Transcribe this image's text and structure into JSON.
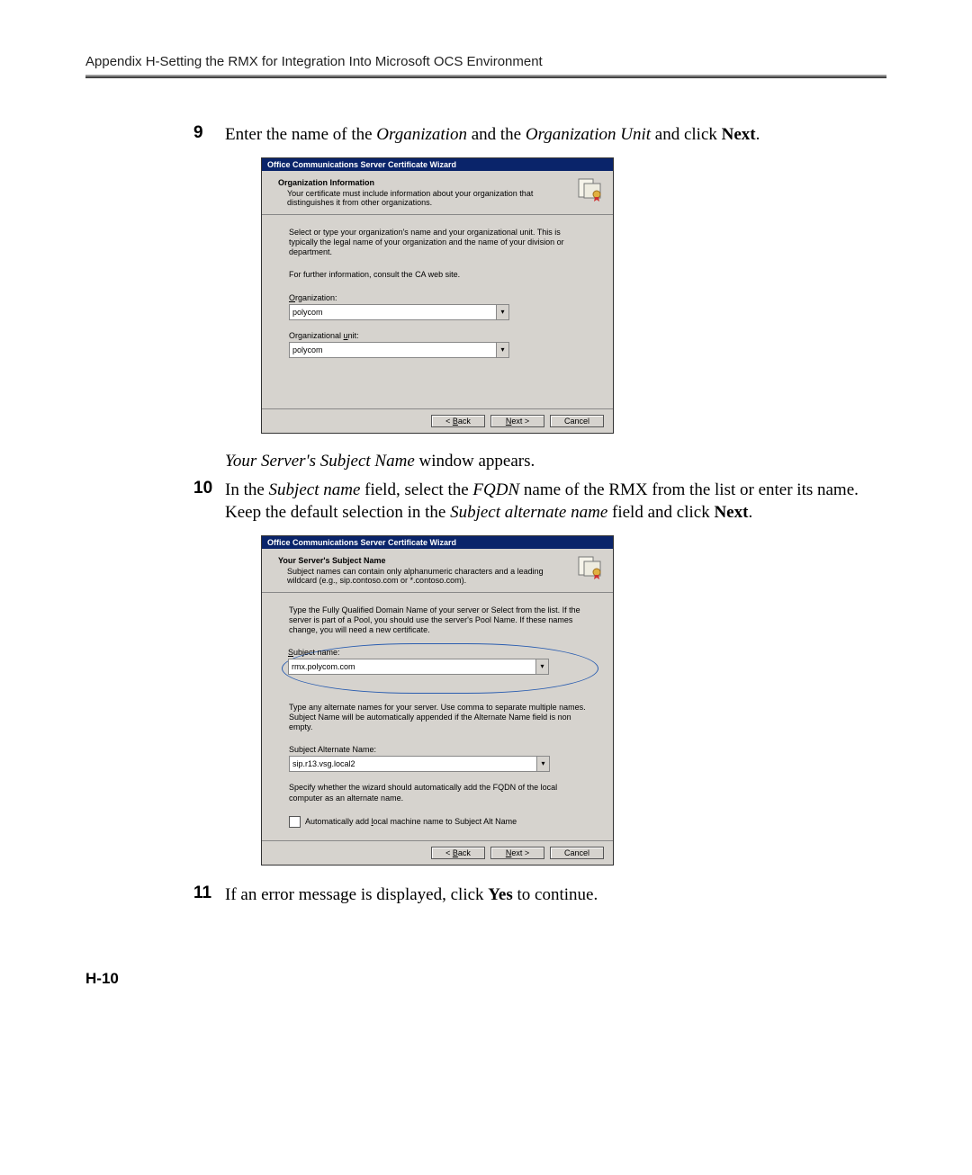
{
  "header": "Appendix H-Setting the RMX for Integration Into Microsoft OCS Environment",
  "steps": {
    "s9": {
      "num": "9",
      "text_a": "Enter the name of the ",
      "text_b_italic": "Organization",
      "text_c": " and the ",
      "text_d_italic": "Organization Unit",
      "text_e": " and click ",
      "text_f_bold": "Next",
      "text_g": "."
    },
    "caption": {
      "a_italic": "Your Server's Subject Name",
      "b": " window appears."
    },
    "s10": {
      "num": "10",
      "l1_a": "In the ",
      "l1_b_italic": "Subject name",
      "l1_c": " field, select the ",
      "l1_d_italic": "FQDN",
      "l1_e": " name of the RMX from the list or enter its name.",
      "l2_a": "Keep the default selection in the ",
      "l2_b_italic": "Subject alternate name",
      "l2_c": " field and click ",
      "l2_d_bold": "Next",
      "l2_e": "."
    },
    "s11": {
      "num": "11",
      "a": "If an error message is displayed, click ",
      "b_bold": "Yes",
      "c": " to continue."
    }
  },
  "dialog1": {
    "title": "Office Communications Server Certificate Wizard",
    "head_title": "Organization Information",
    "head_desc": "Your certificate must include information about your organization that distinguishes it from other organizations.",
    "body_intro": "Select or type your organization's name and your organizational unit. This is typically the legal name of your organization and the name of your division or department.",
    "body_info": "For further information, consult the CA web site.",
    "org_label": "Organization:",
    "org_value": "polycom",
    "ou_label": "Organizational unit:",
    "ou_value": "polycom",
    "btn_back": "< Back",
    "btn_next": "Next >",
    "btn_cancel": "Cancel"
  },
  "dialog2": {
    "title": "Office Communications Server Certificate Wizard",
    "head_title": "Your Server's Subject Name",
    "head_desc": "Subject names can contain only alphanumeric characters and a leading wildcard (e.g., sip.contoso.com or *.contoso.com).",
    "body_intro": "Type the Fully Qualified Domain Name of your server or Select from the list. If the server is part of a Pool, you should use the server's Pool Name. If these names change, you will need a new certificate.",
    "sn_label": "Subject name:",
    "sn_value": "rmx.polycom.com",
    "alt_intro": "Type any alternate names for your server. Use comma to separate multiple names. Subject Name will be automatically appended if the Alternate Name field is non empty.",
    "san_label": "Subject Alternate Name:",
    "san_value": "sip.r13.vsg.local2",
    "auto_intro": "Specify whether the wizard should automatically add the FQDN of the local computer as an alternate name.",
    "chk_label": "Automatically add local machine name to Subject Alt Name",
    "btn_back": "< Back",
    "btn_next": "Next >",
    "btn_cancel": "Cancel"
  },
  "footer": "H-10"
}
